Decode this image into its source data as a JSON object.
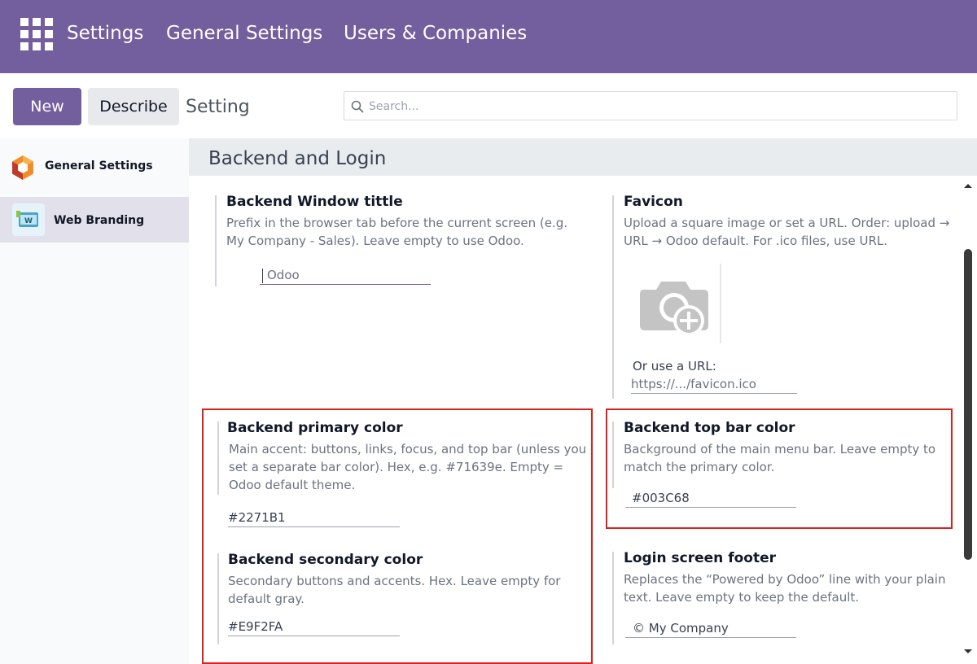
{
  "topbar": {
    "apps_icon": "apps-grid-icon",
    "nav": [
      "Settings",
      "General Settings",
      "Users & Companies"
    ],
    "color": "#735e9e"
  },
  "controls": {
    "new_label": "New",
    "describe_label": "Describe",
    "title": "Setting",
    "search_placeholder": "Search..."
  },
  "sidebar": {
    "items": [
      {
        "label": "General Settings",
        "icon": "odoo-settings-icon",
        "active": false
      },
      {
        "label": "Web Branding",
        "icon": "web-branding-icon",
        "active": true
      }
    ]
  },
  "section": {
    "title": "Backend and Login"
  },
  "settings": {
    "window_title": {
      "title": "Backend Window tittle",
      "description": "Prefix in the browser tab before the current screen (e.g. My Company - Sales). Leave empty to use Odoo.",
      "placeholder": "Odoo"
    },
    "favicon": {
      "title": "Favicon",
      "description": "Upload a square image or set a URL. Order: upload → URL → Odoo default. For .ico files, use URL.",
      "upload_icon": "camera-add-icon",
      "url_label": "Or use a URL:",
      "url_placeholder": "https://.../favicon.ico"
    },
    "primary_color": {
      "title": "Backend primary color",
      "description": "Main accent: buttons, links, focus, and top bar (unless you set a separate bar color). Hex, e.g. #71639e. Empty = Odoo default theme.",
      "value": "#2271B1"
    },
    "top_bar_color": {
      "title": "Backend top bar color",
      "description": "Background of the main menu bar. Leave empty to match the primary color.",
      "value": "#003C68"
    },
    "secondary_color": {
      "title": "Backend secondary color",
      "description": "Secondary buttons and accents. Hex. Leave empty for default gray.",
      "value": "#E9F2FA"
    },
    "login_footer": {
      "title": "Login screen footer",
      "description": "Replaces the “Powered by Odoo” line with your plain text. Leave empty to keep the default.",
      "value": "© My Company"
    }
  },
  "highlight_color": "#d9211e"
}
